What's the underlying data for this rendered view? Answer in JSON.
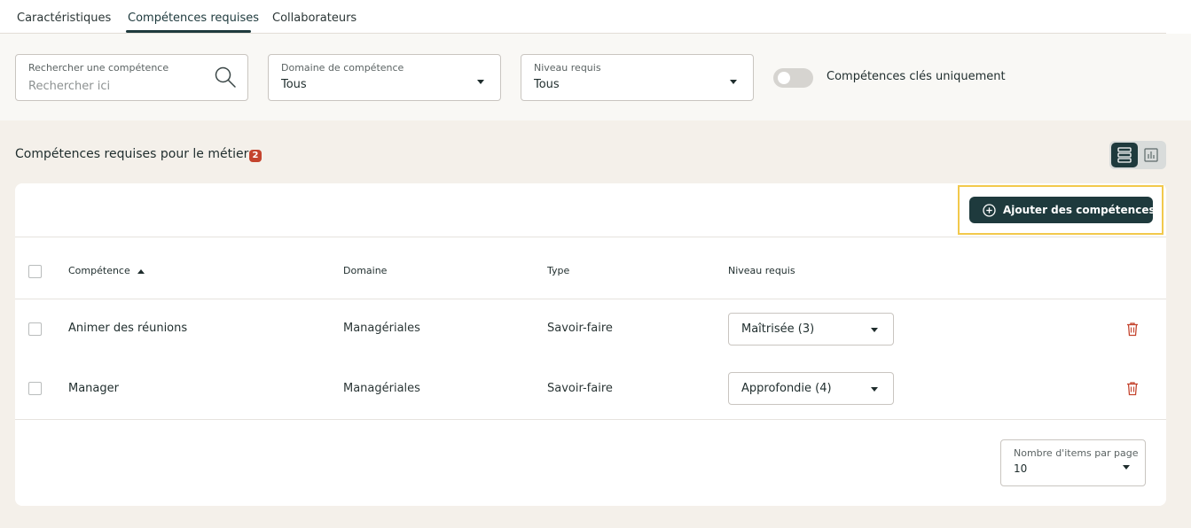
{
  "tabs": [
    {
      "label": "Caractéristiques"
    },
    {
      "label": "Compétences requises"
    },
    {
      "label": "Collaborateurs"
    }
  ],
  "filters": {
    "search": {
      "label": "Rechercher une compétence",
      "placeholder": "Rechercher ici"
    },
    "domain": {
      "label": "Domaine de compétence",
      "value": "Tous"
    },
    "level": {
      "label": "Niveau requis",
      "value": "Tous"
    },
    "key_only": {
      "label": "Compétences clés uniquement",
      "checked": false
    }
  },
  "section": {
    "title": "Compétences requises pour le métier",
    "count": "2"
  },
  "toolbar": {
    "add_label": "Ajouter des compétences"
  },
  "table": {
    "columns": [
      "Compétence",
      "Domaine",
      "Type",
      "Niveau requis"
    ],
    "rows": [
      {
        "competence": "Animer des réunions",
        "domaine": "Managériales",
        "type": "Savoir-faire",
        "niveau": "Maîtrisée (3)"
      },
      {
        "competence": "Manager",
        "domaine": "Managériales",
        "type": "Savoir-faire",
        "niveau": "Approfondie (4)"
      }
    ]
  },
  "pagination": {
    "label": "Nombre d'items par page",
    "value": "10"
  },
  "colors": {
    "primary": "#1e3a3d",
    "badge": "#c4442e",
    "delete": "#c4442e",
    "highlight": "#f2c94c"
  }
}
